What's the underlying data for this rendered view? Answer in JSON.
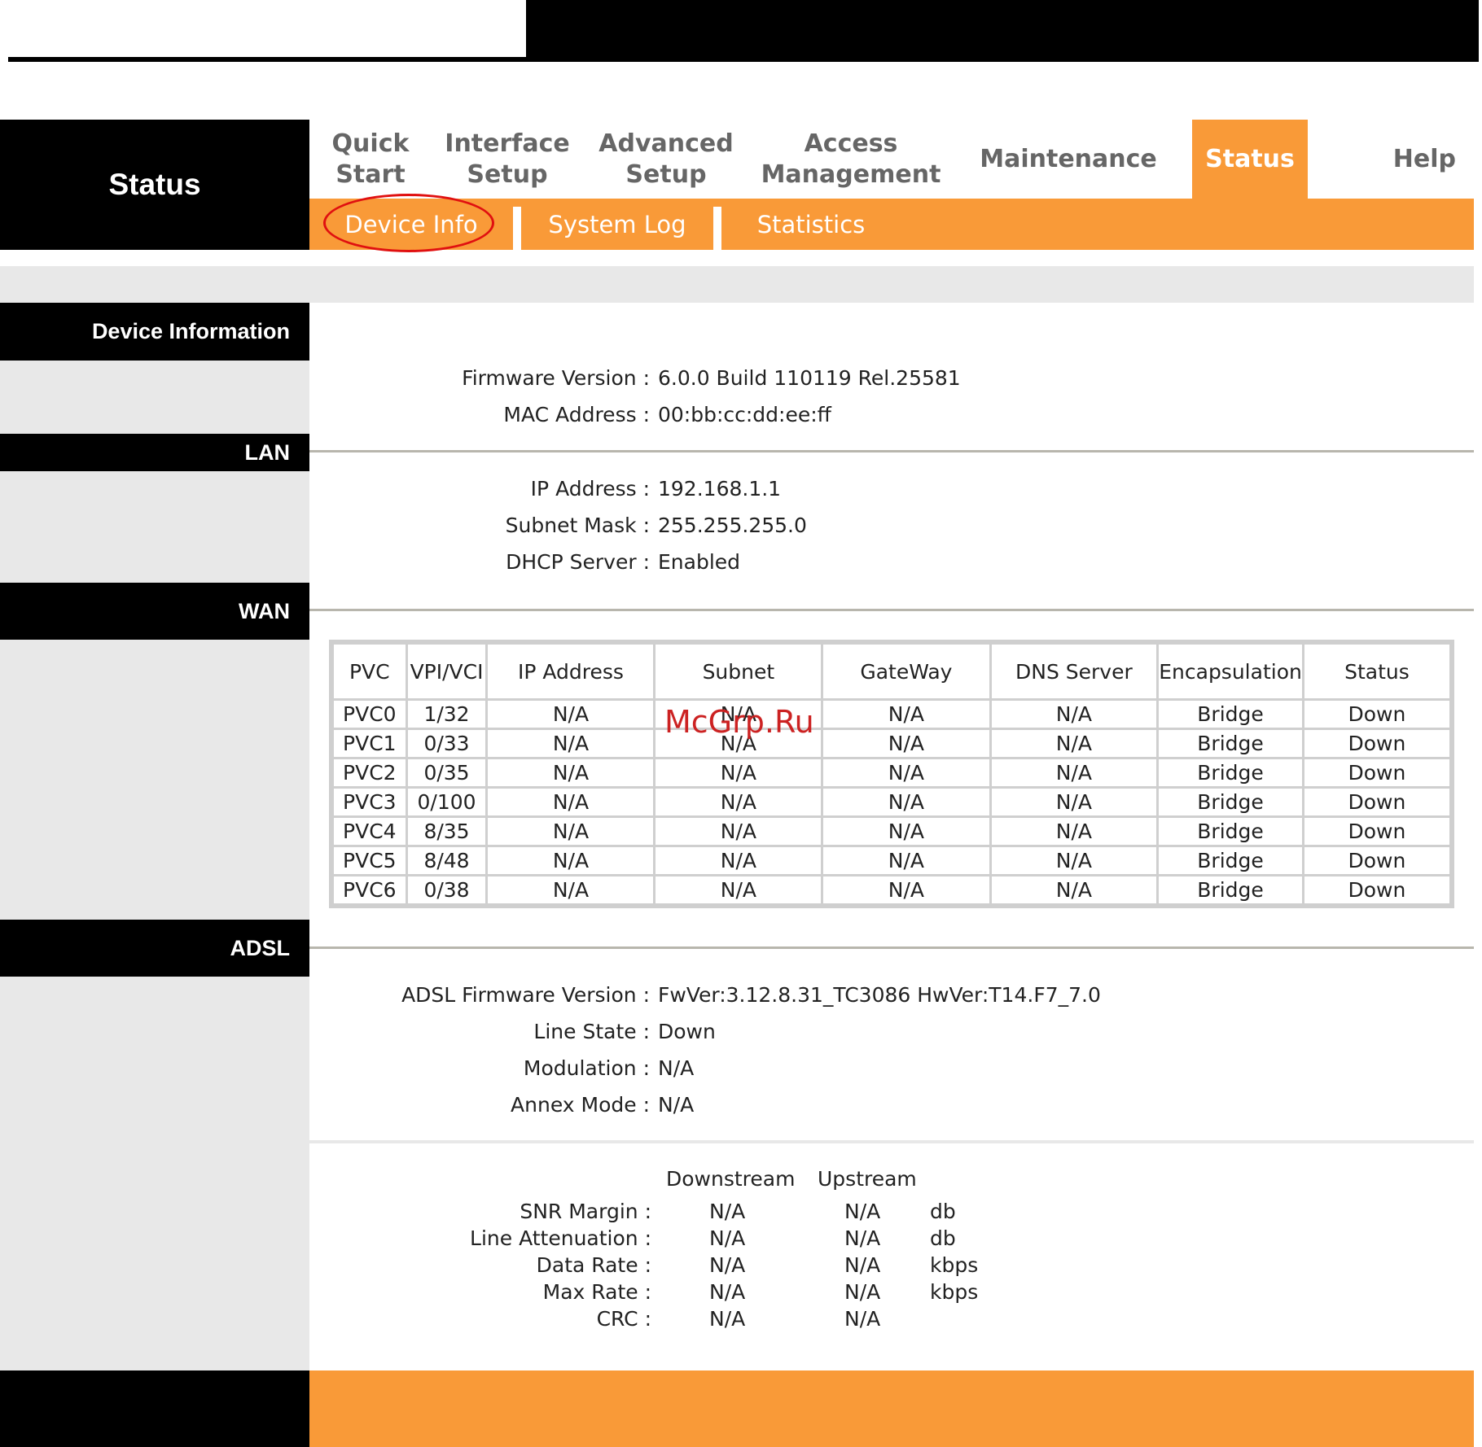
{
  "brand": {
    "title": "Status"
  },
  "nav": {
    "items": [
      {
        "label": "Quick\nStart"
      },
      {
        "label": "Interface\nSetup"
      },
      {
        "label": "Advanced\nSetup"
      },
      {
        "label": "Access\nManagement"
      },
      {
        "label": "Maintenance"
      },
      {
        "label": "Status",
        "active": true
      },
      {
        "label": "Help"
      }
    ],
    "subitems": [
      {
        "label": "Device Info",
        "active": true
      },
      {
        "label": "System Log"
      },
      {
        "label": "Statistics"
      }
    ],
    "active_color": "#f99a38"
  },
  "sections": {
    "device_info": {
      "heading": "Device Information",
      "firmware_label": "Firmware Version :",
      "firmware_value": "6.0.0 Build 110119 Rel.25581",
      "mac_label": "MAC Address :",
      "mac_value": "00:bb:cc:dd:ee:ff"
    },
    "lan": {
      "heading": "LAN",
      "ip_label": "IP Address :",
      "ip_value": "192.168.1.1",
      "mask_label": "Subnet Mask :",
      "mask_value": "255.255.255.0",
      "dhcp_label": "DHCP Server :",
      "dhcp_value": "Enabled"
    },
    "wan": {
      "heading": "WAN",
      "columns": [
        "PVC",
        "VPI/VCI",
        "IP Address",
        "Subnet",
        "GateWay",
        "DNS Server",
        "Encapsulation",
        "Status"
      ],
      "rows": [
        [
          "PVC0",
          "1/32",
          "N/A",
          "N/A",
          "N/A",
          "N/A",
          "Bridge",
          "Down"
        ],
        [
          "PVC1",
          "0/33",
          "N/A",
          "N/A",
          "N/A",
          "N/A",
          "Bridge",
          "Down"
        ],
        [
          "PVC2",
          "0/35",
          "N/A",
          "N/A",
          "N/A",
          "N/A",
          "Bridge",
          "Down"
        ],
        [
          "PVC3",
          "0/100",
          "N/A",
          "N/A",
          "N/A",
          "N/A",
          "Bridge",
          "Down"
        ],
        [
          "PVC4",
          "8/35",
          "N/A",
          "N/A",
          "N/A",
          "N/A",
          "Bridge",
          "Down"
        ],
        [
          "PVC5",
          "8/48",
          "N/A",
          "N/A",
          "N/A",
          "N/A",
          "Bridge",
          "Down"
        ],
        [
          "PVC6",
          "0/38",
          "N/A",
          "N/A",
          "N/A",
          "N/A",
          "Bridge",
          "Down"
        ]
      ]
    },
    "adsl": {
      "heading": "ADSL",
      "fw_label": "ADSL Firmware Version :",
      "fw_value": "FwVer:3.12.8.31_TC3086 HwVer:T14.F7_7.0",
      "line_state_label": "Line State :",
      "line_state_value": "Down",
      "modulation_label": "Modulation :",
      "modulation_value": "N/A",
      "annex_label": "Annex Mode :",
      "annex_value": "N/A",
      "stats": {
        "downstream_header": "Downstream",
        "upstream_header": "Upstream",
        "rows": [
          {
            "label": "SNR Margin :",
            "down": "N/A",
            "up": "N/A",
            "unit": "db"
          },
          {
            "label": "Line Attenuation :",
            "down": "N/A",
            "up": "N/A",
            "unit": "db"
          },
          {
            "label": "Data Rate :",
            "down": "N/A",
            "up": "N/A",
            "unit": "kbps"
          },
          {
            "label": "Max Rate :",
            "down": "N/A",
            "up": "N/A",
            "unit": "kbps"
          },
          {
            "label": "CRC :",
            "down": "N/A",
            "up": "N/A",
            "unit": ""
          }
        ]
      }
    }
  },
  "watermark": "McGrp.Ru"
}
